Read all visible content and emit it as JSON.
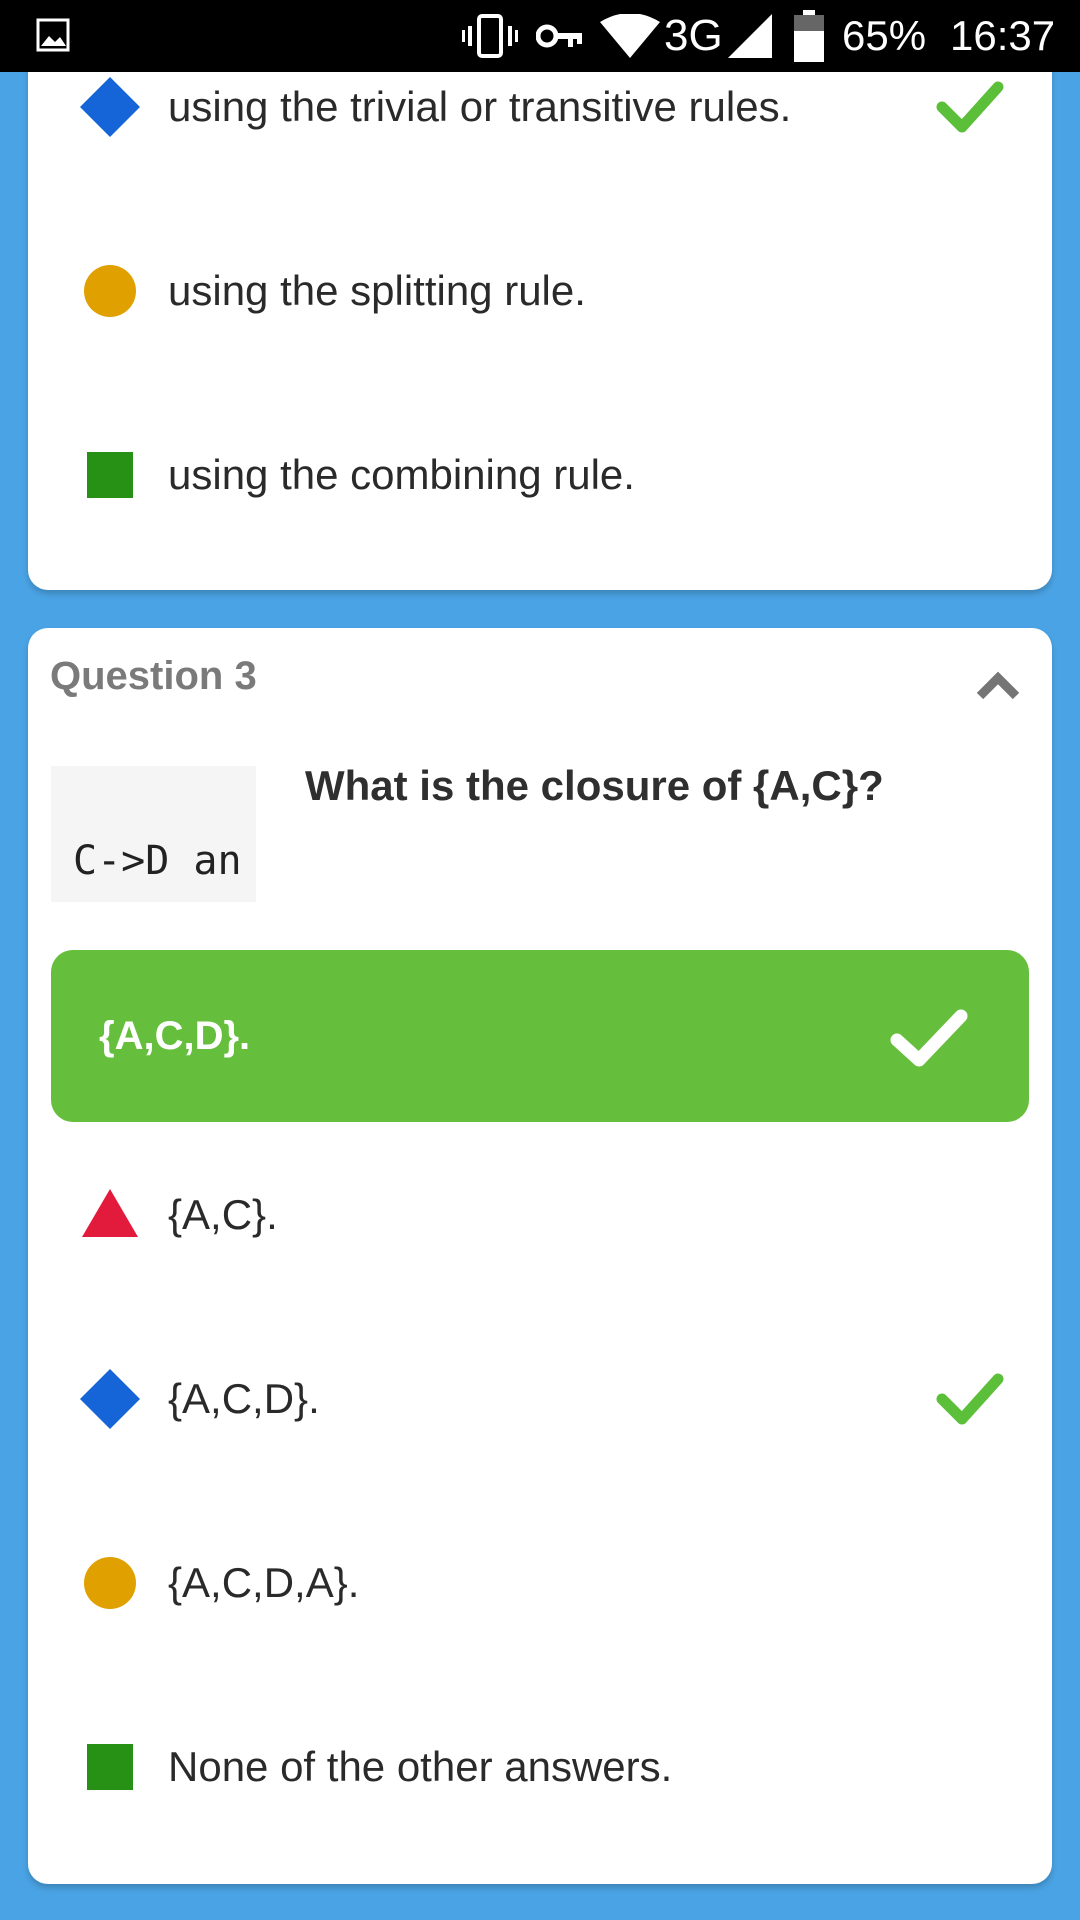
{
  "status_bar": {
    "network": "3G",
    "battery": "65%",
    "time": "16:37",
    "icons": [
      "gallery-icon",
      "vibrate-icon",
      "vpn-key-icon",
      "wifi-icon",
      "signal-icon",
      "battery-icon"
    ]
  },
  "previous_question": {
    "options": [
      {
        "label": "using the trivial or transitive rules.",
        "shape": "diamond",
        "color": "#1565d8",
        "marked_correct": true
      },
      {
        "label": "using the splitting rule.",
        "shape": "circle",
        "color": "#e0a100",
        "marked_correct": false
      },
      {
        "label": "using the combining rule.",
        "shape": "square",
        "color": "#279115",
        "marked_correct": false
      }
    ]
  },
  "question3": {
    "title": "Question 3",
    "code_snippet": "C->D an",
    "text": "What is the closure of {A,C}?",
    "correct_answer": "{A,C,D}.",
    "options": [
      {
        "label": "{A,C}.",
        "shape": "triangle",
        "color": "#e21b3c",
        "marked_correct": false
      },
      {
        "label": "{A,C,D}.",
        "shape": "diamond",
        "color": "#1565d8",
        "marked_correct": true
      },
      {
        "label": "{A,C,D,A}.",
        "shape": "circle",
        "color": "#e0a100",
        "marked_correct": false
      },
      {
        "label": "None of the other answers.",
        "shape": "square",
        "color": "#279115",
        "marked_correct": false
      }
    ]
  },
  "colors": {
    "background": "#4aa3e4",
    "correct_green": "#66bf3c",
    "check_green": "#5cbf3a"
  }
}
